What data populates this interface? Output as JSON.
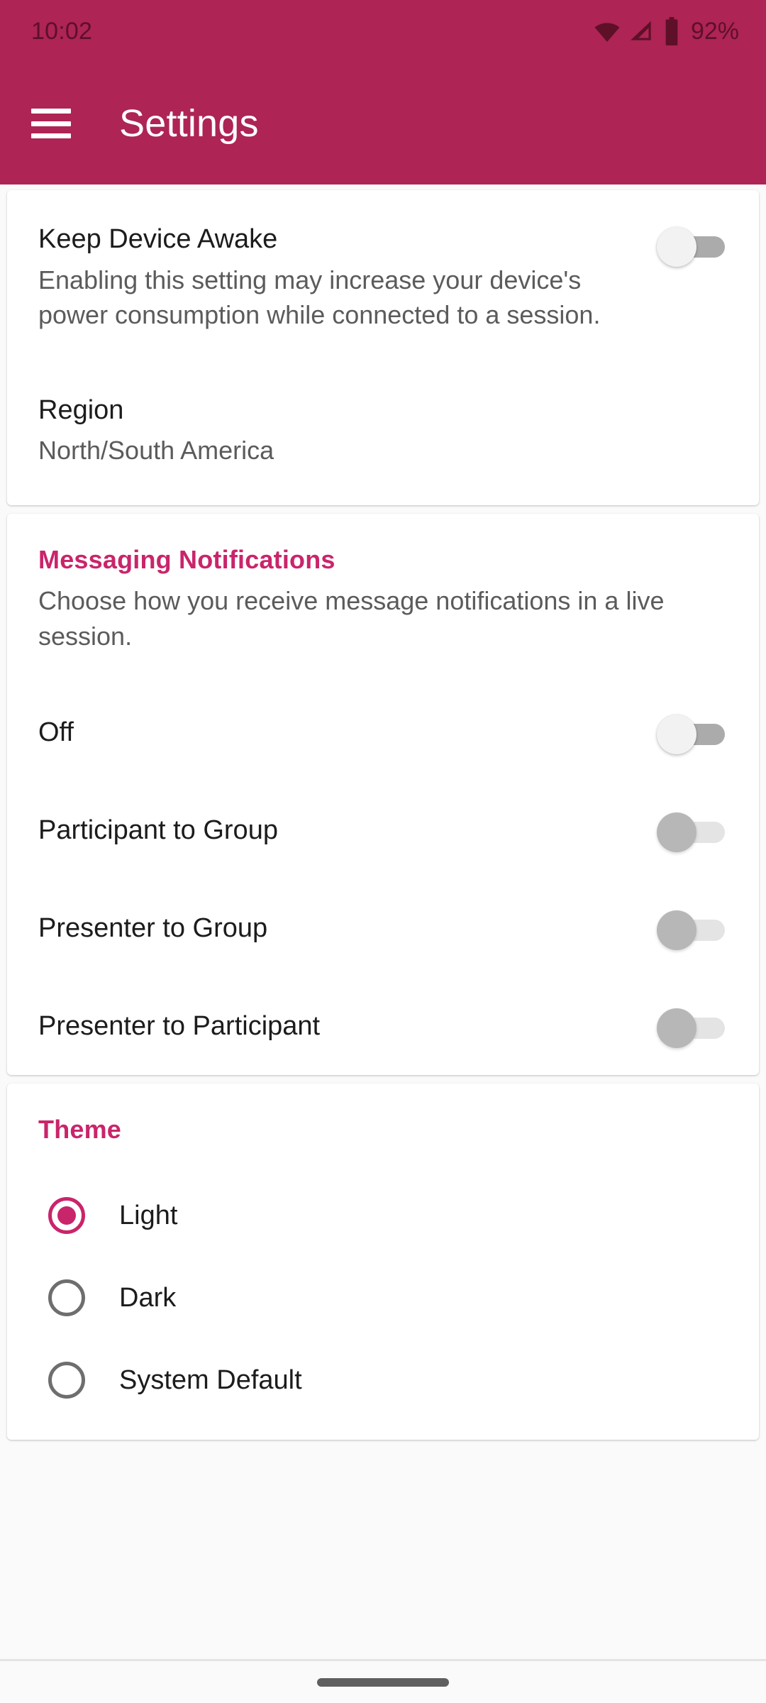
{
  "statusbar": {
    "time": "10:02",
    "battery_percent": "92%",
    "icons": [
      "wifi-icon",
      "cellular-signal-icon",
      "battery-icon"
    ]
  },
  "appbar": {
    "menu_icon": "hamburger-menu-icon",
    "title": "Settings",
    "background_color": "#AD2455"
  },
  "theme_colors": {
    "primary": "#AD2455",
    "accent": "#C9256B",
    "page_background": "#FAFAFA",
    "card_background": "#FFFFFF"
  },
  "general_card": {
    "keep_awake": {
      "title": "Keep Device Awake",
      "description": "Enabling this setting may increase your device's power consumption while connected to a session.",
      "toggle_state": "off"
    },
    "region": {
      "title": "Region",
      "value": "North/South America"
    }
  },
  "messaging_card": {
    "section_title": "Messaging Notifications",
    "section_description": "Choose how you receive message notifications in a live session.",
    "options": [
      {
        "label": "Off",
        "toggle_state": "off",
        "disabled": false
      },
      {
        "label": "Participant to Group",
        "toggle_state": "off",
        "disabled": true
      },
      {
        "label": "Presenter to Group",
        "toggle_state": "off",
        "disabled": true
      },
      {
        "label": "Presenter to Participant",
        "toggle_state": "off",
        "disabled": true
      }
    ]
  },
  "theme_card": {
    "section_title": "Theme",
    "options": [
      {
        "label": "Light",
        "selected": true
      },
      {
        "label": "Dark",
        "selected": false
      },
      {
        "label": "System Default",
        "selected": false
      }
    ]
  },
  "navbar": {
    "gesture_pill": "home-gesture-pill"
  }
}
